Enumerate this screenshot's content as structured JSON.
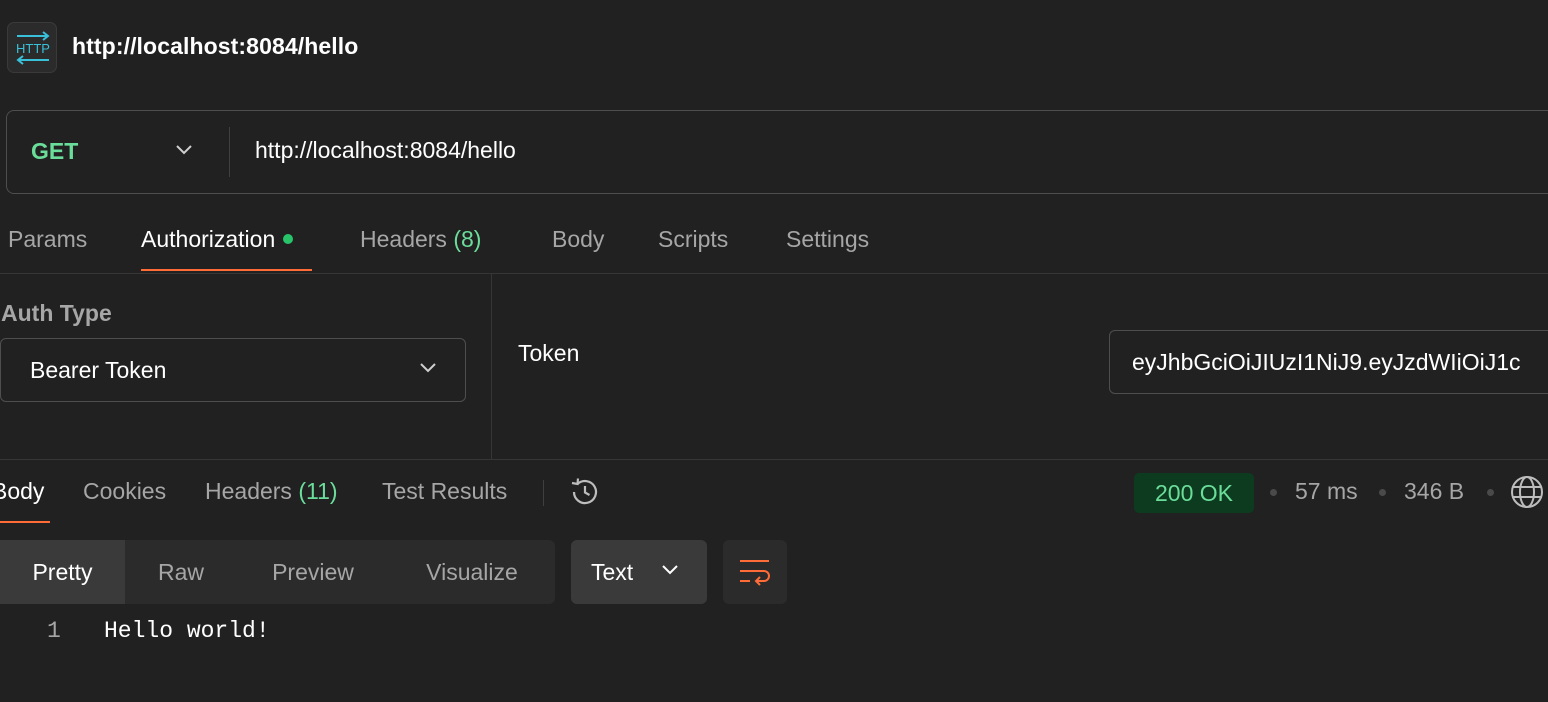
{
  "header": {
    "badge_icon": "http-icon",
    "title": "http://localhost:8084/hello"
  },
  "request": {
    "method": "GET",
    "url": "http://localhost:8084/hello",
    "method_color": "#6bdd9a"
  },
  "request_tabs": {
    "params": "Params",
    "authorization": "Authorization",
    "headers": "Headers",
    "headers_count": "(8)",
    "body": "Body",
    "scripts": "Scripts",
    "settings": "Settings",
    "active": "Authorization"
  },
  "auth": {
    "type_label": "Auth Type",
    "type_value": "Bearer Token",
    "token_label": "Token",
    "token_value": "eyJhbGciOiJIUzI1NiJ9.eyJzdWIiOiJ1c"
  },
  "response_tabs": {
    "body": "Body",
    "cookies": "Cookies",
    "headers": "Headers",
    "headers_count": "(11)",
    "test_results": "Test Results",
    "active": "Body"
  },
  "response_meta": {
    "status": "200 OK",
    "time": "57 ms",
    "size": "346 B",
    "status_color": "#6bdd9a"
  },
  "view_controls": {
    "pretty": "Pretty",
    "raw": "Raw",
    "preview": "Preview",
    "visualize": "Visualize",
    "active": "Pretty",
    "format": "Text"
  },
  "response_body": {
    "lines": [
      {
        "number": "1",
        "content": "Hello world!"
      }
    ]
  },
  "colors": {
    "background": "#212121",
    "accent": "#ff6c37",
    "success": "#6bdd9a"
  }
}
